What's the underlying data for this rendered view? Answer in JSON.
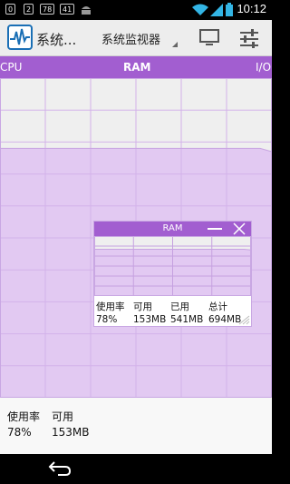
{
  "status_bar": {
    "badges": [
      "0",
      "2",
      "78",
      "41"
    ],
    "time": "10:12"
  },
  "action_bar": {
    "title": "系统...",
    "spinner_value": "系统监视器"
  },
  "tabs": {
    "left": "CPU",
    "center": "RAM",
    "right": "I/O"
  },
  "colors": {
    "accent": "#a25ed0",
    "fill": "#e2c9f2"
  },
  "chart_data": {
    "type": "area",
    "series": [
      {
        "values": [
          78,
          78,
          78,
          78,
          78,
          78,
          78,
          78,
          78,
          78,
          78,
          78,
          78,
          78,
          78,
          78,
          78,
          78,
          78,
          78,
          78,
          78,
          78,
          77
        ]
      }
    ],
    "ylim": [
      0,
      100
    ],
    "grid": true
  },
  "ram_window": {
    "title": "RAM",
    "labels": [
      "使用率",
      "可用",
      "已用",
      "总计"
    ],
    "values": [
      "78%",
      "153MB",
      "541MB",
      "694MB"
    ]
  },
  "bottom_info": {
    "usage_label": "使用率",
    "available_label": "可用",
    "usage_value": "78%",
    "available_value": "153MB"
  }
}
